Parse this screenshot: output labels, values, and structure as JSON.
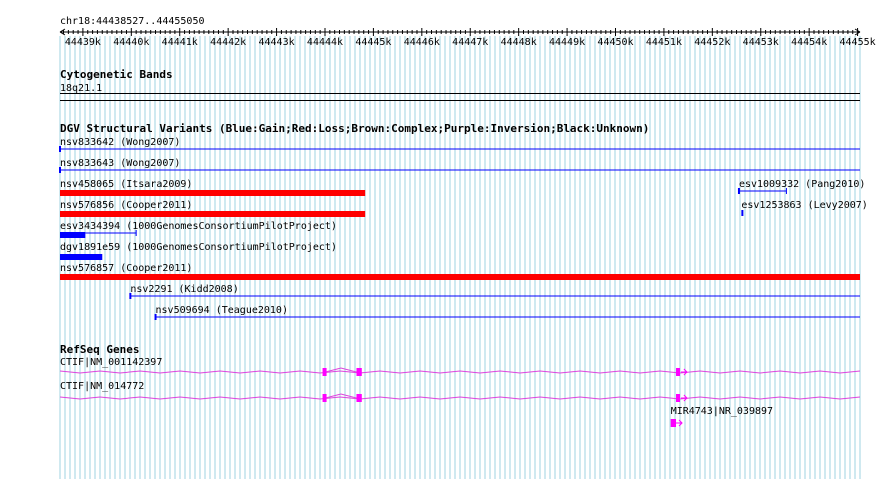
{
  "view": {
    "location": "chr18:44438527..44455050",
    "start": 44438527,
    "end": 44455050
  },
  "ruler": {
    "labels": [
      "44439k",
      "44440k",
      "44441k",
      "44442k",
      "44443k",
      "44444k",
      "44445k",
      "44446k",
      "44447k",
      "44448k",
      "44449k",
      "44450k",
      "44451k",
      "44452k",
      "44453k",
      "44454k",
      "44455k"
    ]
  },
  "colors": {
    "grid": "#9fd3e0",
    "gain": "#0000ff",
    "loss": "#ff0000",
    "gene": "#dd44dd",
    "exon": "#ff00ff"
  },
  "tracks": {
    "cytoband": {
      "title": "Cytogenetic Bands",
      "band": "18q21.1"
    },
    "dgv": {
      "title": "DGV Structural Variants (Blue:Gain;Red:Loss;Brown:Complex;Purple:Inversion;Black:Unknown)",
      "features": [
        {
          "label": "nsv833642 (Wong2007)",
          "kind": "gain-line",
          "start": 44438527,
          "end": 44455050
        },
        {
          "label": "nsv833643 (Wong2007)",
          "kind": "gain-line",
          "start": 44438527,
          "end": 44455050
        },
        {
          "label": "nsv458065 (Itsara2009)",
          "kind": "loss-bar",
          "start": 44438527,
          "end": 44444830
        },
        {
          "label": "nsv576856 (Cooper2011)",
          "kind": "loss-bar",
          "start": 44438527,
          "end": 44444830
        },
        {
          "label": "esv3434394 (1000GenomesConsortiumPilotProject)",
          "kind": "gain-bar-tail",
          "start": 44438527,
          "end": 44440100,
          "solid_end": 44439050
        },
        {
          "label": "dgv1891e59 (1000GenomesConsortiumPilotProject)",
          "kind": "gain-bar",
          "start": 44438527,
          "end": 44439400
        },
        {
          "label": "nsv576857 (Cooper2011)",
          "kind": "loss-bar",
          "start": 44438527,
          "end": 44455050
        },
        {
          "label": "nsv2291 (Kidd2008)",
          "kind": "gain-line",
          "start": 44439980,
          "end": 44455050
        },
        {
          "label": "nsv509694 (Teague2010)",
          "kind": "gain-line",
          "start": 44440500,
          "end": 44455050
        },
        {
          "label": "esv1009332 (Pang2010)",
          "kind": "gain-line",
          "start": 44452550,
          "end": 44453530
        },
        {
          "label": "esv1253863 (Levy2007)",
          "kind": "gain-tick",
          "start": 44452600,
          "end": 44452640
        }
      ]
    },
    "refseq": {
      "title": "RefSeq Genes",
      "genes": [
        {
          "label": "CTIF|NM_001142397",
          "start": 44438527,
          "end": 44455050,
          "exons": [
            [
              44443950,
              44444010
            ],
            [
              44444650,
              44444760
            ],
            [
              44451250,
              44451310
            ]
          ]
        },
        {
          "label": "CTIF|NM_014772",
          "start": 44438527,
          "end": 44455050,
          "exons": [
            [
              44443950,
              44444010
            ],
            [
              44444650,
              44444760
            ],
            [
              44451250,
              44451310
            ]
          ]
        },
        {
          "label": "MIR4743|NR_039897",
          "start": 44451140,
          "end": 44451400,
          "exons": [
            [
              44451140,
              44451250
            ]
          ]
        }
      ]
    }
  }
}
